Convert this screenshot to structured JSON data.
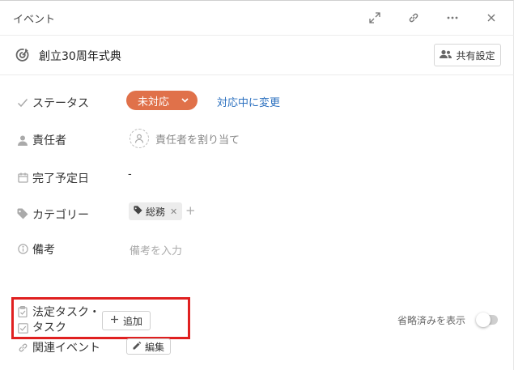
{
  "header": {
    "title": "イベント",
    "icons": [
      "expand-icon",
      "link-icon",
      "more-icon",
      "close-icon"
    ]
  },
  "event": {
    "title": "創立30周年式典",
    "share_label": "共有設定"
  },
  "fields": {
    "status": {
      "label": "ステータス",
      "value": "未対応",
      "link": "対応中に変更",
      "color": "#e0714a"
    },
    "assignee": {
      "label": "責任者",
      "placeholder": "責任者を割り当て"
    },
    "due_date": {
      "label": "完了予定日",
      "value": "-"
    },
    "category": {
      "label": "カテゴリー",
      "tag": "総務",
      "tag_remove": "✕",
      "add": "+"
    },
    "memo": {
      "label": "備考",
      "placeholder": "備考を入力"
    }
  },
  "legal_tasks": {
    "label_line1": "法定タスク・",
    "label_line2": "タスク",
    "add_label": "追加"
  },
  "show_completed": {
    "label": "省略済みを表示",
    "enabled": false
  },
  "related_event": {
    "label": "関連イベント",
    "edit_label": "編集"
  }
}
